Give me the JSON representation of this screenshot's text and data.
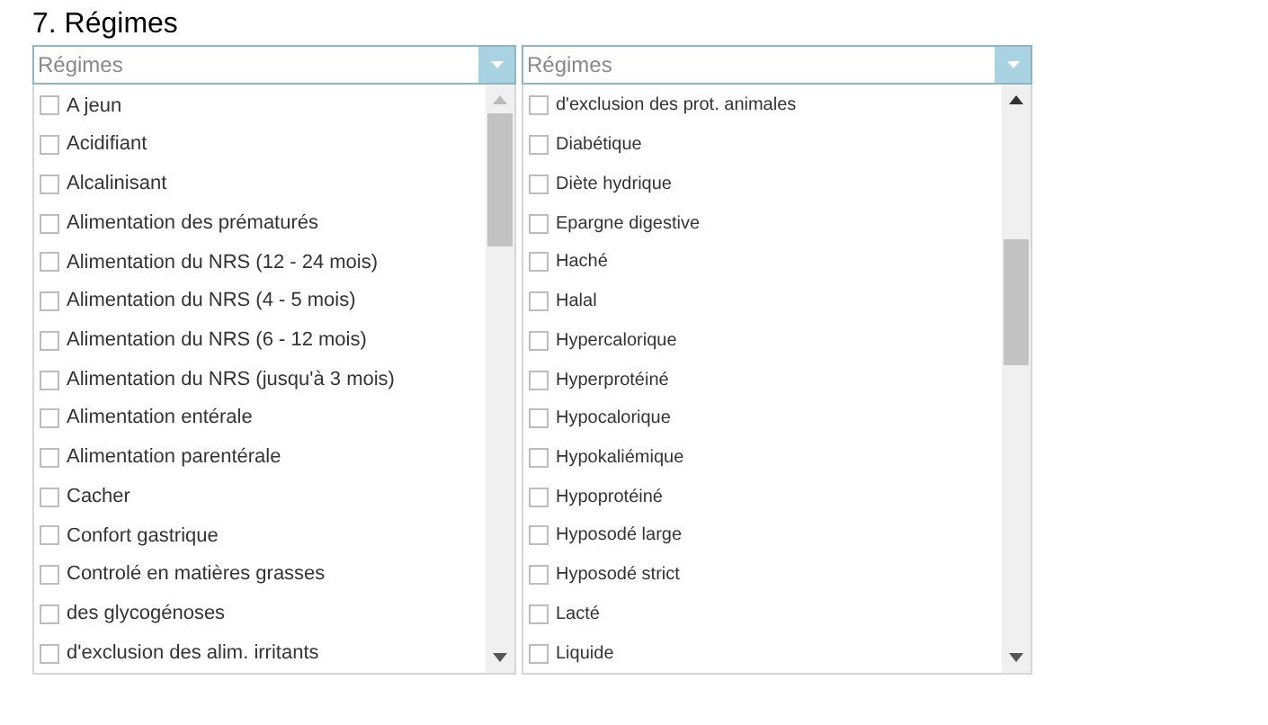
{
  "title": "7. Régimes",
  "dropdowns": [
    {
      "placeholder": "Régimes",
      "items": [
        {
          "label": "A jeun",
          "checked": false
        },
        {
          "label": "Acidifiant",
          "checked": false
        },
        {
          "label": "Alcalinisant",
          "checked": false
        },
        {
          "label": "Alimentation des prématurés",
          "checked": false
        },
        {
          "label": "Alimentation du NRS (12 - 24 mois)",
          "checked": false
        },
        {
          "label": "Alimentation du NRS (4 - 5 mois)",
          "checked": false
        },
        {
          "label": "Alimentation du NRS (6 - 12 mois)",
          "checked": false
        },
        {
          "label": "Alimentation du NRS (jusqu'à 3 mois)",
          "checked": false
        },
        {
          "label": "Alimentation entérale",
          "checked": false
        },
        {
          "label": "Alimentation parentérale",
          "checked": false
        },
        {
          "label": "Cacher",
          "checked": false
        },
        {
          "label": "Confort gastrique",
          "checked": false
        },
        {
          "label": "Controlé en matières grasses",
          "checked": false
        },
        {
          "label": "des glycogénoses",
          "checked": false
        },
        {
          "label": "d'exclusion des alim. irritants",
          "checked": false
        }
      ]
    },
    {
      "placeholder": "Régimes",
      "items": [
        {
          "label": "d'exclusion des prot. animales",
          "checked": false
        },
        {
          "label": "Diabétique",
          "checked": false
        },
        {
          "label": "Diète hydrique",
          "checked": false
        },
        {
          "label": "Epargne digestive",
          "checked": false
        },
        {
          "label": "Haché",
          "checked": false
        },
        {
          "label": "Halal",
          "checked": false
        },
        {
          "label": "Hypercalorique",
          "checked": false
        },
        {
          "label": "Hyperprotéiné",
          "checked": false
        },
        {
          "label": "Hypocalorique",
          "checked": false
        },
        {
          "label": "Hypokaliémique",
          "checked": false
        },
        {
          "label": "Hypoprotéiné",
          "checked": false
        },
        {
          "label": "Hyposodé large",
          "checked": false
        },
        {
          "label": "Hyposodé strict",
          "checked": false
        },
        {
          "label": "Lacté",
          "checked": false
        },
        {
          "label": "Liquide",
          "checked": false
        }
      ]
    }
  ]
}
